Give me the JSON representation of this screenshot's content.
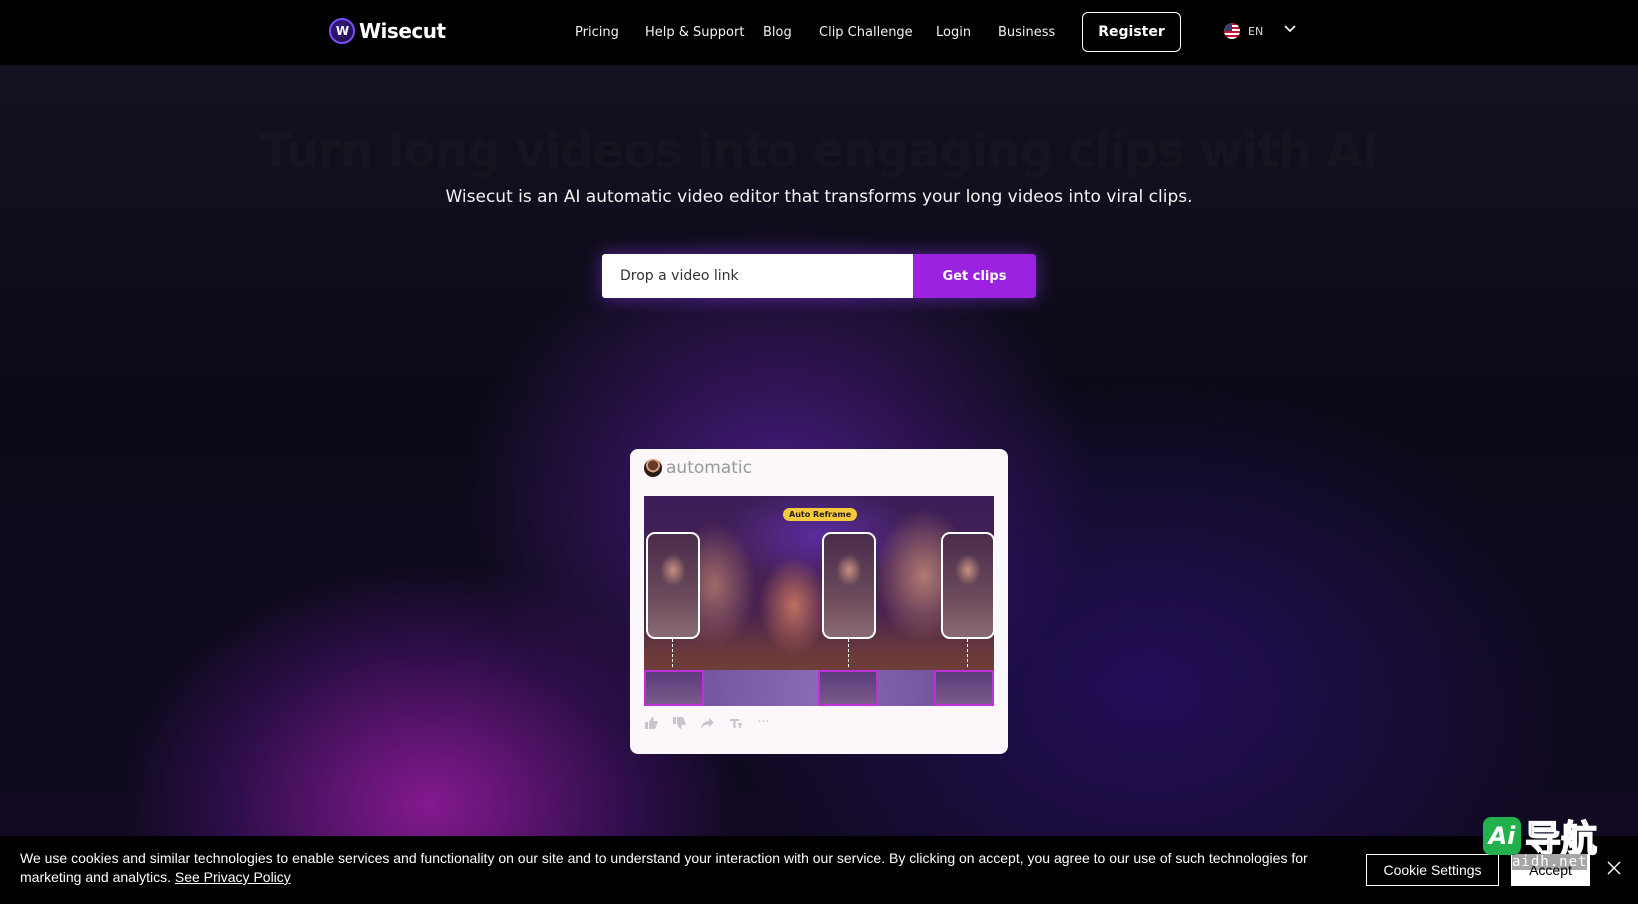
{
  "header": {
    "brand": "Wisecut",
    "logo_mark": "W",
    "nav": [
      "Pricing",
      "Help & Support",
      "Blog",
      "Clip Challenge",
      "Login",
      "Business"
    ],
    "register_label": "Register",
    "language": "EN"
  },
  "hero": {
    "title": "Turn long videos into engaging clips with AI",
    "subtitle": "Wisecut is an AI automatic video editor that transforms your long videos into viral clips.",
    "input_placeholder": "Drop a video link",
    "cta_label": "Get clips"
  },
  "demo": {
    "header_word": "automatic",
    "badge": "Auto Reframe",
    "actions": [
      "thumb-up-icon",
      "thumb-down-icon",
      "share-icon",
      "subtitles-icon",
      "more-icon"
    ],
    "more_glyph": "···"
  },
  "cookie": {
    "text": "We use cookies and similar technologies to enable services and functionality on our site and to understand your interaction with our service. By clicking on accept, you agree to our use of such technologies for marketing and analytics.",
    "privacy_link": "See Privacy Policy",
    "settings_label": "Cookie Settings",
    "accept_label": "Accept"
  },
  "watermark": {
    "logo": "Ai",
    "chinese": "导航",
    "url": "aidh.net"
  },
  "colors": {
    "accent": "#9b22e0",
    "badge": "#f7c93c",
    "header_bg": "#000000"
  }
}
